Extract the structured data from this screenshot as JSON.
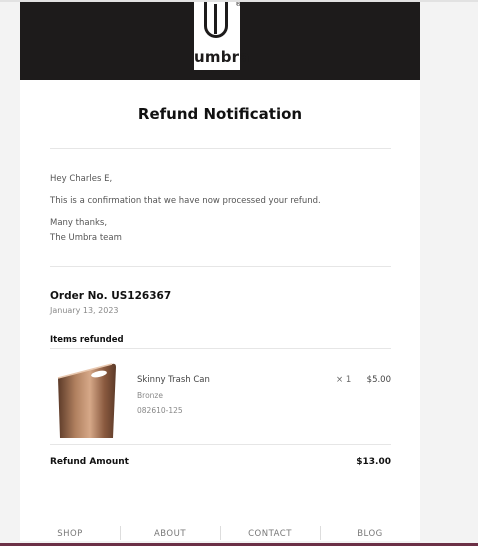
{
  "brand": {
    "logo_text": "umbra",
    "logo_mark": "®"
  },
  "email": {
    "title": "Refund Notification",
    "greeting": "Hey Charles E,",
    "body": "This is a confirmation that we have now processed your refund.",
    "signoff_1": "Many thanks,",
    "signoff_2": "The Umbra team"
  },
  "order": {
    "number": "Order No. US126367",
    "date": "January 13, 2023",
    "items_heading": "Items refunded",
    "items": [
      {
        "name": "Skinny Trash Can",
        "variant": "Bronze",
        "sku": "082610-125",
        "quantity": "× 1",
        "price": "$5.00",
        "image": "bronze-trash-can-image"
      }
    ],
    "refund_label": "Refund Amount",
    "refund_amount": "$13.00"
  },
  "footer": {
    "links": [
      "SHOP",
      "ABOUT",
      "CONTACT",
      "BLOG"
    ]
  },
  "colors": {
    "header_bg": "#1d1b1b",
    "bronze": "#9a6a4d",
    "bottom_bar": "#6b3046"
  }
}
